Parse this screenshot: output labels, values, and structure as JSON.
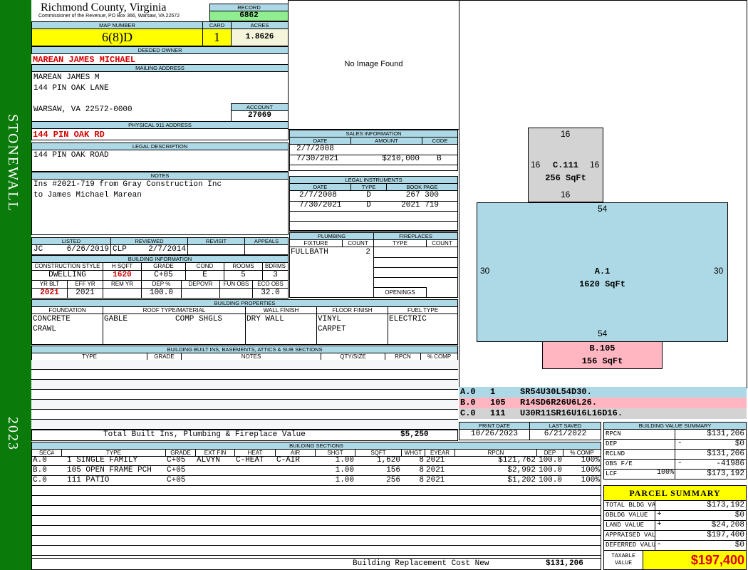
{
  "side": {
    "district": "STONEWALL",
    "year": "2023"
  },
  "header": {
    "title": "Richmond County, Virginia",
    "subtitle": "Commissioner of the Revenue, PO Box 366, Warsaw, VA 22572",
    "record_label": "RECORD",
    "record": "6862"
  },
  "map": {
    "map_label": "MAP NUMBER",
    "map_number": "6(8)D",
    "card_label": "CARD",
    "card": "1",
    "acres_label": "ACRES",
    "acres": "1.8626"
  },
  "owner": {
    "label": "DEEDED OWNER",
    "name": "MAREAN JAMES MICHAEL"
  },
  "mailing": {
    "label": "MAILING ADDRESS",
    "line1": "MAREAN JAMES M",
    "line2": "144 PIN OAK LANE",
    "line3": "WARSAW, VA 22572-0000",
    "account_label": "ACCOUNT",
    "account": "27069"
  },
  "physical": {
    "label": "PHYSICAL 911 ADDRESS",
    "address": "144 PIN OAK RD"
  },
  "legal": {
    "label": "LEGAL DESCRIPTION",
    "text": "144 PIN OAK ROAD"
  },
  "notes": {
    "label": "NOTES",
    "line1": "Ins #2021-719 from Gray Construction Inc",
    "line2": "to James Michael Marean"
  },
  "image": {
    "text": "No Image Found"
  },
  "sales": {
    "label": "SALES INFORMATION",
    "cols": [
      "DATE",
      "AMOUNT",
      "CODE"
    ],
    "rows": [
      [
        "2/7/2008",
        "",
        ""
      ],
      [
        "7/30/2021",
        "$210,000",
        "B"
      ]
    ]
  },
  "instruments": {
    "label": "LEGAL INSTRUMENTS",
    "cols": [
      "DATE",
      "TYPE",
      "BOOK PAGE"
    ],
    "rows": [
      [
        "2/7/2008",
        "D",
        "267 300"
      ],
      [
        "7/30/2021",
        "D",
        "2021 719"
      ]
    ]
  },
  "review": {
    "listed_label": "LISTED",
    "reviewed_label": "REVIEWED",
    "revisit_label": "REVISIT",
    "appeals_label": "APPEALS",
    "listed_by": "JC",
    "listed_date": "6/26/2019",
    "reviewed_by": "CLP",
    "reviewed_date": "2/7/2014"
  },
  "plumbing": {
    "label": "PLUMBING",
    "fixture_label": "FIXTURE",
    "count_label": "COUNT",
    "fixture": "FULLBATH",
    "count": "2"
  },
  "fireplaces": {
    "label": "FIREPLACES",
    "type_label": "TYPE",
    "count_label": "COUNT",
    "openings_label": "OPENINGS"
  },
  "bldg_info": {
    "label": "BUILDING INFORMATION",
    "style_label": "CONSTRUCTION STYLE",
    "style": "DWELLING",
    "hsqft_label": "H SQFT",
    "hsqft": "1620",
    "grade_label": "GRADE",
    "grade": "C+05",
    "cond_label": "COND",
    "cond": "E",
    "rooms_label": "ROOMS",
    "rooms": "5",
    "bdrms_label": "BDRMS",
    "bdrms": "3",
    "yrblt_label": "YR BLT",
    "yrblt": "2021",
    "effyr_label": "EFF YR",
    "effyr": "2021",
    "remyr_label": "REM YR",
    "dep_label": "DEP %",
    "dep": "100.0",
    "depovr_label": "DEPOVR",
    "funobs_label": "FUN OBS",
    "ecoobs_label": "ECO OBS",
    "ecoobs": "32.0"
  },
  "bldg_props": {
    "label": "BUILDING PROPERTIES",
    "foundation_label": "FOUNDATION",
    "foundation1": "CONCRETE",
    "foundation2": "CRAWL",
    "roof_label": "ROOF TYPE/MATERIAL",
    "roof_type": "GABLE",
    "roof_material": "COMP SHGLS",
    "wall_label": "WALL FINISH",
    "wall": "DRY WALL",
    "floor_label": "FLOOR FINISH",
    "floor1": "VINYL",
    "floor2": "CARPET",
    "fuel_label": "FUEL TYPE",
    "fuel": "ELECTRIC"
  },
  "builtins": {
    "label": "BUILDING BUILT INS, BASEMENTS, ATTICS & SUB SECTIONS",
    "cols": [
      "TYPE",
      "GRADE",
      "NOTES",
      "QTY/SIZE",
      "RPCN",
      "% COMP"
    ],
    "total_label": "Total Built Ins, Plumbing & Fireplace Value",
    "total": "$5,250"
  },
  "sections": {
    "label": "BUILDING SECTIONS",
    "cols": [
      "SEC#",
      "TYPE",
      "GRADE",
      "EXT FIN",
      "HEAT",
      "AIR",
      "SHGT",
      "SQFT",
      "WHGT",
      "EYEAR",
      "RPCN",
      "DEP",
      "% COMP"
    ],
    "rows": [
      [
        "A.0",
        "1 SINGLE FAMILY",
        "C+05",
        "ALVYN",
        "C-HEAT",
        "C-AIR",
        "1.00",
        "1,620",
        "8",
        "2021",
        "$121,762",
        "100.0",
        "100%"
      ],
      [
        "B.0",
        "105 OPEN FRAME PCH",
        "C+05",
        "",
        "",
        "",
        "1.00",
        "156",
        "8",
        "2021",
        "$2,992",
        "100.0",
        "100%"
      ],
      [
        "C.0",
        "111 PATIO",
        "C+05",
        "",
        "",
        "",
        "1.00",
        "256",
        "8",
        "2021",
        "$1,202",
        "100.0",
        "100%"
      ]
    ],
    "total_label": "Building Replacement Cost New",
    "total": "$131,206"
  },
  "sketch": {
    "a_label": "A.1",
    "a_area": "1620 SqFt",
    "a_top": "54",
    "a_bottom": "54",
    "a_left": "30",
    "a_right": "30",
    "b_label": "B.105",
    "b_area": "156 SqFt",
    "c_label": "C.111",
    "c_area": "256 SqFt",
    "c_top": "16",
    "c_bottom": "16",
    "c_left": "16",
    "c_right": "16",
    "lines": [
      {
        "sec": "A.0",
        "code": "1",
        "path": "SR54U30L54D30.",
        "color": "#add8e6"
      },
      {
        "sec": "B.0",
        "code": "105",
        "path": "R14SD6R26U6L26.",
        "color": "#ffb6c1"
      },
      {
        "sec": "C.0",
        "code": "111",
        "path": "U30R11SR16U16L16D16.",
        "color": "#d3d3d3"
      }
    ]
  },
  "dates": {
    "print_label": "PRINT DATE",
    "print": "10/26/2023",
    "saved_label": "LAST SAVED",
    "saved": "6/21/2022"
  },
  "bvs": {
    "label": "BUILDING VALUE SUMMARY",
    "rows": [
      {
        "label": "RPCN",
        "op": "",
        "value": "$131,206"
      },
      {
        "label": "DEP",
        "op": "-",
        "value": "$0"
      },
      {
        "label": "RCLND",
        "op": "",
        "value": "$131,206"
      },
      {
        "label": "OBS F/E",
        "op": "-",
        "value": "-41986"
      },
      {
        "label": "LCF",
        "pct": "100%",
        "op": "",
        "value": "$173,192"
      }
    ]
  },
  "parcel": {
    "label": "PARCEL SUMMARY",
    "rows": [
      {
        "label": "TOTAL BLDG VALUE",
        "op": "",
        "value": "$173,192"
      },
      {
        "label": "OBLDG VALUE",
        "op": "+",
        "value": "$0"
      },
      {
        "label": "LAND VALUE",
        "op": "+",
        "value": "$24,208"
      },
      {
        "label": "APPRAISED VALUE",
        "op": "",
        "value": "$197,400"
      },
      {
        "label": "DEFERRED VALUE",
        "op": "-",
        "value": "$0"
      }
    ],
    "taxable_label1": "TAXABLE",
    "taxable_label2": "VALUE",
    "taxable": "$197,400"
  },
  "colors": {
    "green": "#0a7a0a",
    "header_blue": "#add8e6",
    "yellow": "#ffff00",
    "red": "#d40000"
  }
}
